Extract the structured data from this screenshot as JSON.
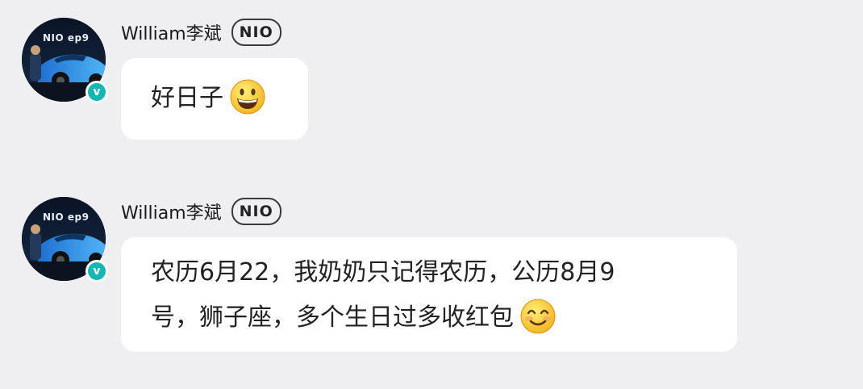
{
  "messages": [
    {
      "author": "William李斌",
      "badge": "NIO",
      "avatar_caption": "NIO ep9",
      "text": "好日子",
      "emoji": "grinning-face"
    },
    {
      "author": "William李斌",
      "badge": "NIO",
      "avatar_caption": "NIO ep9",
      "text_line1": "农历6月22，我奶奶只记得农历，公历8月9",
      "text_line2": "号，狮子座，多个生日过多收红包",
      "emoji": "smiling-face-with-smiling-eyes"
    }
  ],
  "colors": {
    "background": "#efeff2",
    "bubble": "#ffffff",
    "verified_badge": "#16b7b3"
  }
}
